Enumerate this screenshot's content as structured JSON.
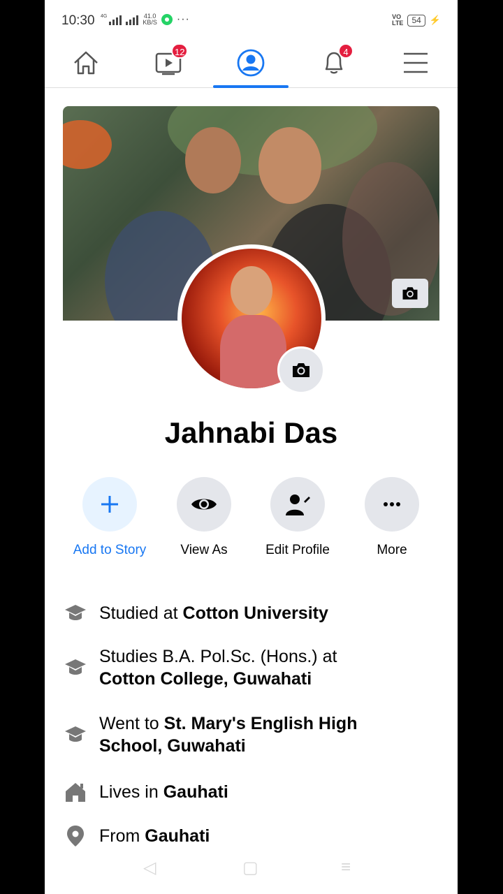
{
  "status_bar": {
    "time": "10:30",
    "network_label": "4G",
    "net_speed_value": "41.0",
    "net_speed_unit": "KB/S",
    "more_glyph": "···",
    "volte_line1": "VO",
    "volte_line2": "LTE",
    "battery": "54"
  },
  "top_nav": {
    "watch_badge": "12",
    "notifications_badge": "4"
  },
  "profile": {
    "name": "Jahnabi Das"
  },
  "actions": [
    {
      "label": "Add to Story"
    },
    {
      "label": "View As"
    },
    {
      "label": "Edit Profile"
    },
    {
      "label": "More"
    }
  ],
  "details": [
    {
      "prefix": "Studied at ",
      "bold": "Cotton University",
      "icon": "graduation-cap-icon"
    },
    {
      "prefix": "Studies B.A. Pol.Sc. (Hons.) at ",
      "bold": "Cotton College, Guwahati",
      "icon": "graduation-cap-icon"
    },
    {
      "prefix": "Went to ",
      "bold": "St. Mary's English High School, Guwahati",
      "icon": "graduation-cap-icon"
    },
    {
      "prefix": "Lives in ",
      "bold": "Gauhati",
      "icon": "home-icon"
    },
    {
      "prefix": "From ",
      "bold": "Gauhati",
      "icon": "location-pin-icon"
    }
  ],
  "colors": {
    "accent": "#1877f2",
    "badge": "#e41e3f",
    "button_bg": "#e4e6eb",
    "add_story_bg": "#e7f3ff"
  }
}
